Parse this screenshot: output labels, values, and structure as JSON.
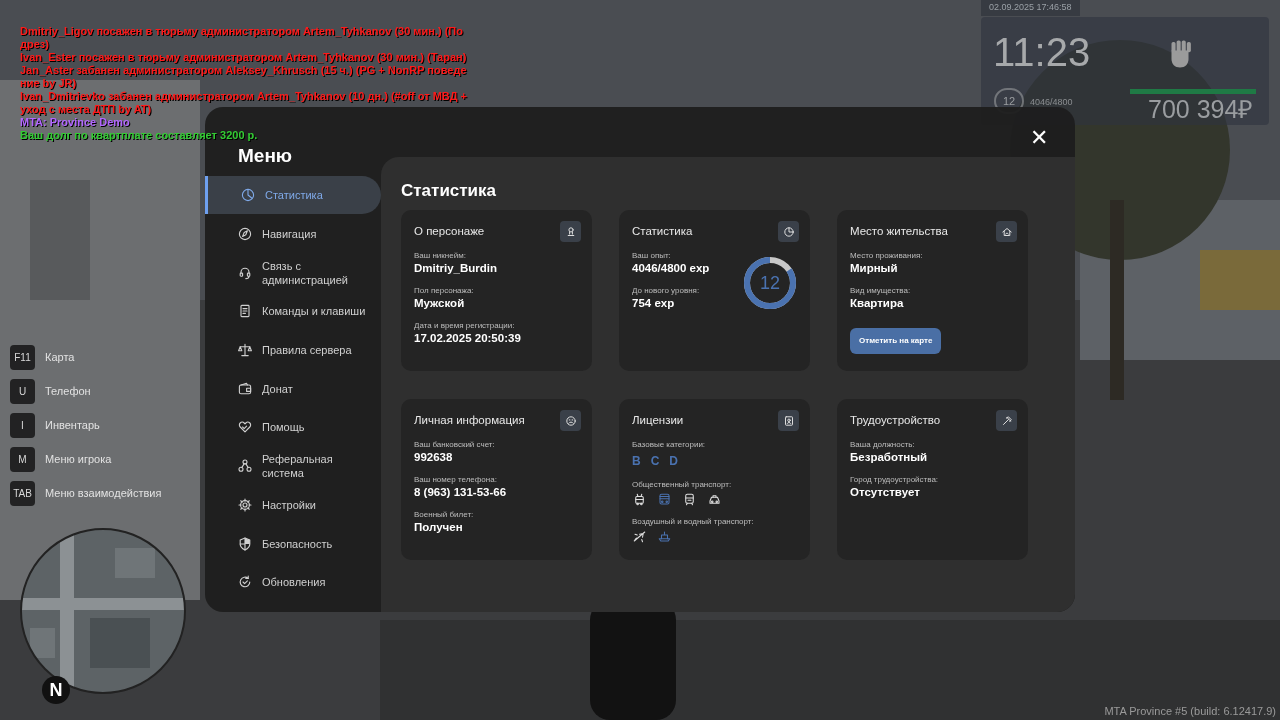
{
  "chat": [
    {
      "text": "Dmitriy_Ligov посажен в тюрьму администратором Artem_Tyhkanov (30 мин.) (Подрез)",
      "color": "#ff1a1a"
    },
    {
      "text": "Ivan_Ester посажен в тюрьму администратором Artem_Tyhkanov (30 мин.) (Таран)",
      "color": "#ff1a1a"
    },
    {
      "text": "Jan_Aster забанен администратором Aleksey_Khrusch (15 ч.) (PG + NonRP поведение by JR)",
      "color": "#ff1a1a"
    },
    {
      "text": "Ivan_Dmitrievko забанен администратором Artem_Tyhkanov (10 дн.) (#off от МВД + уход с места ДТП by AT)",
      "color": "#ff1a1a"
    },
    {
      "text": "MTA: Province Demo",
      "color": "#b266ff"
    },
    {
      "text": "Ваш долг по квартплате составляет 3200 р.",
      "color": "#33cc33"
    }
  ],
  "hud": {
    "datetime": "02.09.2025 17:46:58",
    "time": "11:23",
    "player_level": "12",
    "experience": "4046/4800",
    "bar": {
      "level": 1
    },
    "money": "700 394₽"
  },
  "hotkeys": [
    {
      "key": "F11",
      "label": "Карта"
    },
    {
      "key": "U",
      "label": "Телефон"
    },
    {
      "key": "I",
      "label": "Инвентарь"
    },
    {
      "key": "M",
      "label": "Меню игрока"
    },
    {
      "key": "TAB",
      "label": "Меню взаимодействия"
    }
  ],
  "minimap": {
    "compass": "N"
  },
  "menu": {
    "title": "Меню",
    "close": "✕",
    "sidebar": [
      {
        "label": "Статистика",
        "selected": true
      },
      {
        "label": "Навигация",
        "selected": false
      },
      {
        "label": "Связь с администрацией",
        "selected": false
      },
      {
        "label": "Команды и клавиши",
        "selected": false
      },
      {
        "label": "Правила сервера",
        "selected": false
      },
      {
        "label": "Донат",
        "selected": false
      },
      {
        "label": "Помощь",
        "selected": false
      },
      {
        "label": "Реферальная система",
        "selected": false
      },
      {
        "label": "Настройки",
        "selected": false
      },
      {
        "label": "Безопасность",
        "selected": false
      },
      {
        "label": "Обновления",
        "selected": false
      }
    ],
    "heading": "Статистика",
    "cards": [
      {
        "kind": "fields",
        "title": "О персонаже",
        "fields": [
          {
            "label": "Ваш никнейм:",
            "value": "Dmitriy_Burdin"
          },
          {
            "label": "Пол персонажа:",
            "value": "Мужской"
          },
          {
            "label": "Дата и время регистрации:",
            "value": "17.02.2025 20:50:39"
          }
        ]
      },
      {
        "kind": "stats",
        "title": "Статистика",
        "fields": [
          {
            "label": "Ваш опыт:",
            "value": "4046/4800 exp"
          },
          {
            "label": "До нового уровня:",
            "value": "754 exp"
          }
        ],
        "ring": {
          "text": "12",
          "level": 0.84
        }
      },
      {
        "kind": "fields",
        "title": "Место жительства",
        "fields": [
          {
            "label": "Место проживания:",
            "value": "Мирный"
          },
          {
            "label": "Вид имущества:",
            "value": "Квартира"
          }
        ],
        "button": "Отметить на карте"
      },
      {
        "kind": "fields",
        "title": "Личная информация",
        "fields": [
          {
            "label": "Ваш банковский счет:",
            "value": "992638"
          },
          {
            "label": "Ваш номер телефона:",
            "value": "8 (963) 131-53-66"
          },
          {
            "label": "Военный билет:",
            "value": "Получен"
          }
        ]
      },
      {
        "kind": "licenses",
        "title": "Лицензии",
        "groups": [
          {
            "label": "Базовые категории:",
            "items": [
              {
                "kind": "letter",
                "text": "B",
                "held": true
              },
              {
                "kind": "letter",
                "text": "C",
                "held": true
              },
              {
                "kind": "letter",
                "text": "D",
                "held": true
              }
            ]
          },
          {
            "label": "Общественный транспорт:",
            "items": [
              {
                "kind": "trolleybus",
                "held": false
              },
              {
                "kind": "bus",
                "held": true
              },
              {
                "kind": "tram",
                "held": false
              },
              {
                "kind": "taxi",
                "held": false
              }
            ]
          },
          {
            "label": "Воздушный и водный транспорт:",
            "items": [
              {
                "kind": "plane",
                "held": false
              },
              {
                "kind": "boat",
                "held": true
              }
            ]
          }
        ]
      },
      {
        "kind": "fields",
        "title": "Трудоустройство",
        "fields": [
          {
            "label": "Ваша должность:",
            "value": "Безработный"
          },
          {
            "label": "Город трудоустройства:",
            "value": "Отсутствует"
          }
        ]
      }
    ]
  },
  "build_info": "MTA Province #5 (build: 6.12417.9)"
}
